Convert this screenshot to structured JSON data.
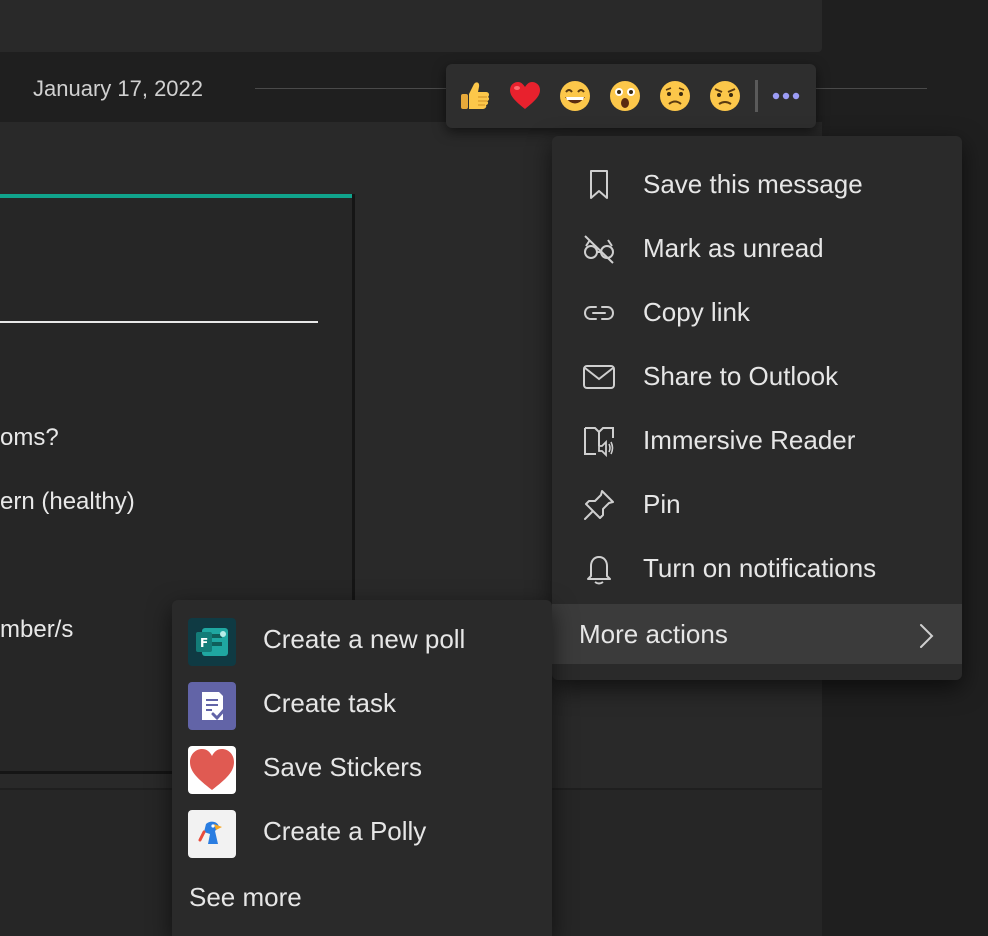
{
  "date_separator": {
    "text": "January 17, 2022"
  },
  "card": {
    "lines": [
      "oms?",
      "ern (healthy)",
      "mber/s"
    ]
  },
  "reactions": [
    {
      "icon": "thumbs-up-icon"
    },
    {
      "icon": "heart-icon"
    },
    {
      "icon": "laugh-icon"
    },
    {
      "icon": "surprised-icon"
    },
    {
      "icon": "sad-icon"
    },
    {
      "icon": "angry-icon"
    }
  ],
  "menu": {
    "items": [
      {
        "label": "Save this message",
        "icon": "bookmark-icon"
      },
      {
        "label": "Mark as unread",
        "icon": "unread-glasses-icon"
      },
      {
        "label": "Copy link",
        "icon": "link-icon"
      },
      {
        "label": "Share to Outlook",
        "icon": "mail-icon"
      },
      {
        "label": "Immersive Reader",
        "icon": "immersive-reader-icon"
      },
      {
        "label": "Pin",
        "icon": "pin-icon"
      },
      {
        "label": "Turn on notifications",
        "icon": "bell-icon"
      }
    ],
    "more_actions": {
      "label": "More actions",
      "icon": "chevron-right-icon"
    }
  },
  "submenu": {
    "items": [
      {
        "label": "Create a new poll",
        "icon": "forms-app-icon"
      },
      {
        "label": "Create task",
        "icon": "tasks-app-icon"
      },
      {
        "label": "Save Stickers",
        "icon": "stickers-heart-icon"
      },
      {
        "label": "Create a Polly",
        "icon": "polly-app-icon"
      }
    ],
    "see_more": "See more"
  },
  "colors": {
    "accent_teal": "#10a38c",
    "more_dots": "#9b9cf5",
    "heart_red": "#e8212d",
    "sticker_heart": "#e05a52",
    "tasks_purple": "#6264a7"
  }
}
